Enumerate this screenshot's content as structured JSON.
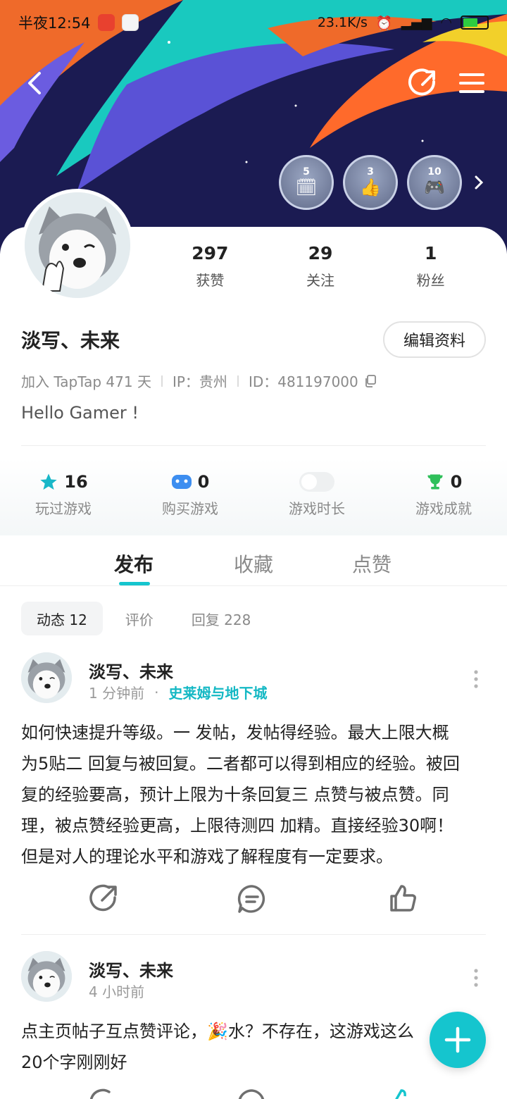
{
  "status_bar": {
    "time": "半夜12:54",
    "net_speed": "23.1K/s",
    "battery": "51"
  },
  "profile": {
    "stats": [
      {
        "value": "297",
        "label": "获赞"
      },
      {
        "value": "29",
        "label": "关注"
      },
      {
        "value": "1",
        "label": "粉丝"
      }
    ],
    "nickname": "淡写、未来",
    "edit_label": "编辑资料",
    "join_info": "加入 TapTap 471 天",
    "ip": "IP：贵州",
    "id": "ID：481197000",
    "bio": "Hello Gamer !",
    "badges": [
      {
        "num": "5",
        "icon": "calendar-gamepad-icon"
      },
      {
        "num": "3",
        "icon": "thumbs-up-icon"
      },
      {
        "num": "10",
        "icon": "gamepad-icon"
      }
    ]
  },
  "game_stats": [
    {
      "value": "16",
      "label": "玩过游戏",
      "icon": "star-icon",
      "color": "#19b7c8"
    },
    {
      "value": "0",
      "label": "购买游戏",
      "icon": "gamepad-icon",
      "color": "#3d8ef0"
    },
    {
      "value": "",
      "label": "游戏时长",
      "icon": "toggle-icon",
      "color": "#eef0f1"
    },
    {
      "value": "0",
      "label": "游戏成就",
      "icon": "trophy-icon",
      "color": "#2fbf5a"
    }
  ],
  "tabs": [
    "发布",
    "收藏",
    "点赞"
  ],
  "subtabs": [
    "动态 12",
    "评价",
    "回复 228"
  ],
  "posts": [
    {
      "author": "淡写、未来",
      "time": "1 分钟前",
      "dot": "·",
      "game": "史莱姆与地下城",
      "lines": [
        "如何快速提升等级。一 发帖，发帖得经验。最大上限大概",
        "为5贴二 回复与被回复。二者都可以得到相应的经验。被回",
        "复的经验要高，预计上限为十条回复三 点赞与被点赞。同",
        "理，被点赞经验更高，上限待测四 加精。直接经验30啊！",
        "但是对人的理论水平和游戏了解程度有一定要求。"
      ]
    },
    {
      "author": "淡写、未来",
      "time": "4 小时前",
      "lines": [
        "点主页帖子互点赞评论，🎉水？不存在，这游戏这么",
        "20个字刚刚好"
      ]
    }
  ],
  "colors": {
    "accent": "#15c5ce",
    "game_link": "#14b8c4"
  }
}
